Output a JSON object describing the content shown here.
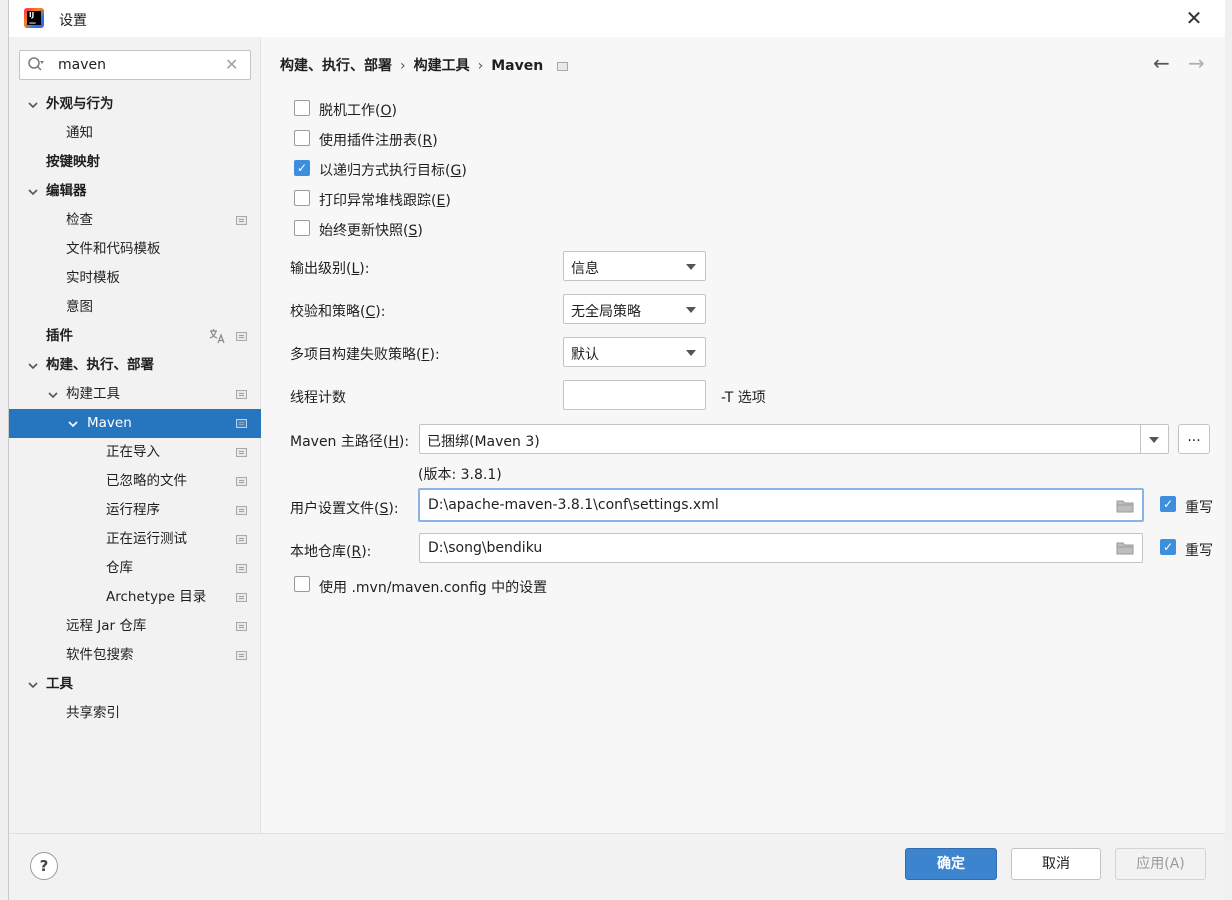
{
  "window": {
    "title": "设置"
  },
  "search": {
    "value": "maven"
  },
  "tree": [
    {
      "label": "外观与行为",
      "level": 0,
      "bold": true,
      "arrow": "v"
    },
    {
      "label": "通知",
      "level": 1
    },
    {
      "label": "按键映射",
      "level": 0,
      "bold": true
    },
    {
      "label": "编辑器",
      "level": 0,
      "bold": true,
      "arrow": "v"
    },
    {
      "label": "检查",
      "level": 1,
      "proj": true
    },
    {
      "label": "文件和代码模板",
      "level": 1
    },
    {
      "label": "实时模板",
      "level": 1
    },
    {
      "label": "意图",
      "level": 1
    },
    {
      "label": "插件",
      "level": 0,
      "bold": true,
      "proj": true,
      "trans": true
    },
    {
      "label": "构建、执行、部署",
      "level": 0,
      "bold": true,
      "arrow": "v"
    },
    {
      "label": "构建工具",
      "level": 1,
      "arrow": "v",
      "proj": true
    },
    {
      "label": "Maven",
      "level": 2,
      "arrow": "v",
      "proj": true,
      "selected": true
    },
    {
      "label": "正在导入",
      "level": 3,
      "proj": true
    },
    {
      "label": "已忽略的文件",
      "level": 3,
      "proj": true
    },
    {
      "label": "运行程序",
      "level": 3,
      "proj": true
    },
    {
      "label": "正在运行测试",
      "level": 3,
      "proj": true
    },
    {
      "label": "仓库",
      "level": 3,
      "proj": true
    },
    {
      "label": "Archetype 目录",
      "level": 3,
      "proj": true
    },
    {
      "label": "远程 Jar 仓库",
      "level": 1,
      "proj": true
    },
    {
      "label": "软件包搜索",
      "level": 1,
      "proj": true
    },
    {
      "label": "工具",
      "level": 0,
      "bold": true,
      "arrow": "v"
    },
    {
      "label": "共享索引",
      "level": 1
    }
  ],
  "breadcrumb": {
    "part1": "构建、执行、部署",
    "part2": "构建工具",
    "part3": "Maven",
    "sep": "›"
  },
  "options": {
    "offline": {
      "label": "脱机工作(",
      "key": "O",
      "end": ")",
      "checked": false
    },
    "plugin_registry": {
      "label": "使用插件注册表(",
      "key": "R",
      "end": ")",
      "checked": false
    },
    "recursive": {
      "label": "以递归方式执行目标(",
      "key": "G",
      "end": ")",
      "checked": true,
      "mark": "✓"
    },
    "stacktrace": {
      "label": "打印异常堆栈跟踪(",
      "key": "E",
      "end": ")",
      "checked": false
    },
    "always_update": {
      "label": "始终更新快照(",
      "key": "S",
      "end": ")",
      "checked": false
    },
    "mvn_config": {
      "label": "使用 .mvn/maven.config 中的设置",
      "checked": false
    }
  },
  "fields": {
    "output_level": {
      "label": "输出级别(",
      "key": "L",
      "end": "):",
      "value": "信息"
    },
    "checksum": {
      "label": "校验和策略(",
      "key": "C",
      "end": "):",
      "value": "无全局策略"
    },
    "fail_policy": {
      "label": "多项目构建失败策略(",
      "key": "F",
      "end": "):",
      "value": "默认"
    },
    "threads": {
      "label": "线程计数",
      "value": "",
      "suffix": "-T 选项"
    },
    "maven_home": {
      "label": "Maven 主路径(",
      "key": "H",
      "end": "):",
      "value": "已捆绑(Maven 3)",
      "browse": "...",
      "version": "(版本: 3.8.1)"
    },
    "user_settings": {
      "label": "用户设置文件(",
      "key": "S",
      "end": "):",
      "value": "D:\\apache-maven-3.8.1\\conf\\settings.xml",
      "override_label": "重写",
      "override_checked": true,
      "mark": "✓"
    },
    "local_repo": {
      "label": "本地仓库(",
      "key": "R",
      "end": "):",
      "value": "D:\\song\\bendiku",
      "override_label": "重写",
      "override_checked": true,
      "mark": "✓"
    }
  },
  "footer": {
    "help": "?",
    "ok": "确定",
    "cancel": "取消",
    "apply": "应用(A)"
  },
  "nav": {
    "back": "←",
    "forward": "→"
  },
  "close_glyph": "✕",
  "clear_glyph": "✕"
}
